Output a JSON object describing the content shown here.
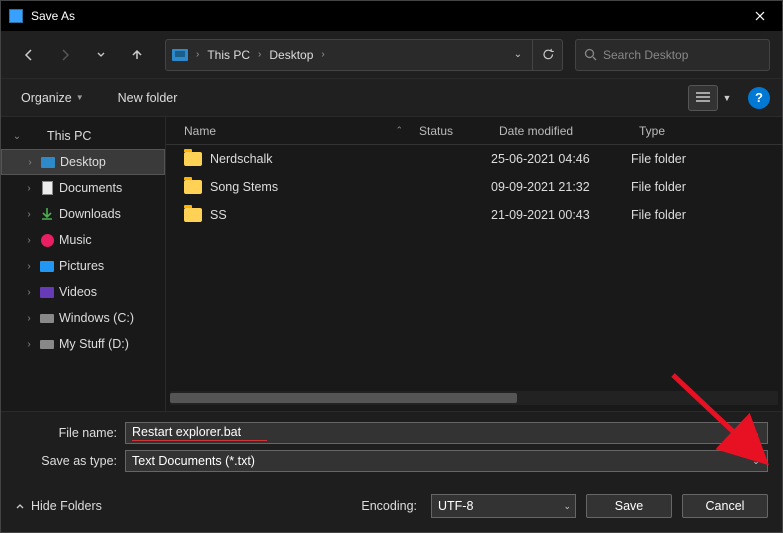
{
  "titlebar": {
    "title": "Save As"
  },
  "breadcrumb": {
    "root": "This PC",
    "folder": "Desktop"
  },
  "search": {
    "placeholder": "Search Desktop"
  },
  "toolbar": {
    "organize": "Organize",
    "newfolder": "New folder"
  },
  "tree": {
    "root": "This PC",
    "items": [
      {
        "label": "Desktop"
      },
      {
        "label": "Documents"
      },
      {
        "label": "Downloads"
      },
      {
        "label": "Music"
      },
      {
        "label": "Pictures"
      },
      {
        "label": "Videos"
      },
      {
        "label": "Windows (C:)"
      },
      {
        "label": "My Stuff (D:)"
      }
    ]
  },
  "columns": {
    "name": "Name",
    "status": "Status",
    "date": "Date modified",
    "type": "Type"
  },
  "files": [
    {
      "name": "Nerdschalk",
      "date": "25-06-2021 04:46",
      "type": "File folder"
    },
    {
      "name": "Song Stems",
      "date": "09-09-2021 21:32",
      "type": "File folder"
    },
    {
      "name": "SS",
      "date": "21-09-2021 00:43",
      "type": "File folder"
    }
  ],
  "form": {
    "filename_label": "File name:",
    "filename_value": "Restart explorer.bat",
    "savetype_label": "Save as type:",
    "savetype_value": "Text Documents (*.txt)"
  },
  "footer": {
    "hidefolders": "Hide Folders",
    "encoding_label": "Encoding:",
    "encoding_value": "UTF-8",
    "save": "Save",
    "cancel": "Cancel"
  }
}
